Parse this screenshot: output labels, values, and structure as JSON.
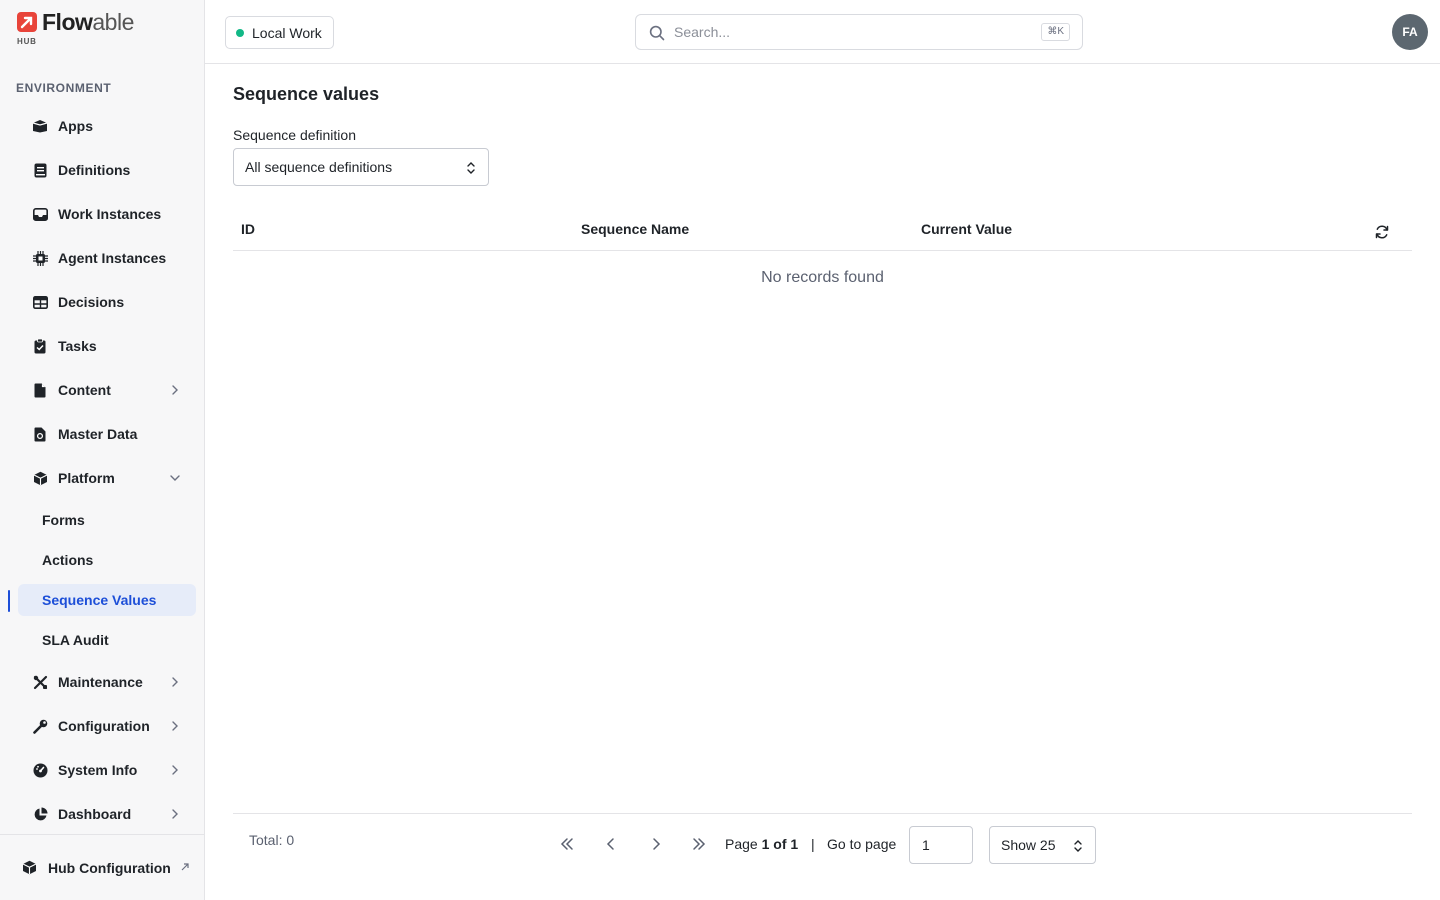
{
  "brand": {
    "name_strong": "Flow",
    "name_soft": "able",
    "sub": "HUB",
    "accent": "#e8443a"
  },
  "sidebar": {
    "section_label": "ENVIRONMENT",
    "items": [
      {
        "label": "Apps",
        "icon": "box-open-icon"
      },
      {
        "label": "Definitions",
        "icon": "book-icon"
      },
      {
        "label": "Work Instances",
        "icon": "inbox-icon"
      },
      {
        "label": "Agent Instances",
        "icon": "cpu-icon"
      },
      {
        "label": "Decisions",
        "icon": "table-icon"
      },
      {
        "label": "Tasks",
        "icon": "clipboard-check-icon"
      },
      {
        "label": "Content",
        "icon": "file-icon",
        "expandable": true
      },
      {
        "label": "Master Data",
        "icon": "file-db-icon"
      },
      {
        "label": "Platform",
        "icon": "cube-icon",
        "expanded": true
      }
    ],
    "platform_children": [
      {
        "label": "Forms"
      },
      {
        "label": "Actions"
      },
      {
        "label": "Sequence Values",
        "active": true
      },
      {
        "label": "SLA Audit"
      }
    ],
    "items_after": [
      {
        "label": "Maintenance",
        "icon": "tools-icon"
      },
      {
        "label": "Configuration",
        "icon": "wrench-icon"
      },
      {
        "label": "System Info",
        "icon": "gauge-icon"
      },
      {
        "label": "Dashboard",
        "icon": "pie-chart-icon"
      }
    ],
    "bottom": {
      "label": "Hub Configuration",
      "icon": "cube-icon"
    },
    "active_color": "#1d4fd8"
  },
  "topbar": {
    "workspace": "Local Work",
    "workspace_status_color": "#12b886",
    "search_placeholder": "Search...",
    "search_shortcut": "⌘K",
    "avatar_initials": "FA"
  },
  "main": {
    "title": "Sequence values",
    "filter_label": "Sequence definition",
    "filter_value": "All sequence definitions",
    "columns": [
      "ID",
      "Sequence Name",
      "Current Value"
    ],
    "empty_text": "No records found",
    "footer": {
      "total": "Total: 0",
      "page_prefix": "Page",
      "page_current": "1 of 1",
      "separator": "|",
      "goto_label": "Go to page",
      "goto_value": "1",
      "show_label": "Show 25"
    }
  }
}
